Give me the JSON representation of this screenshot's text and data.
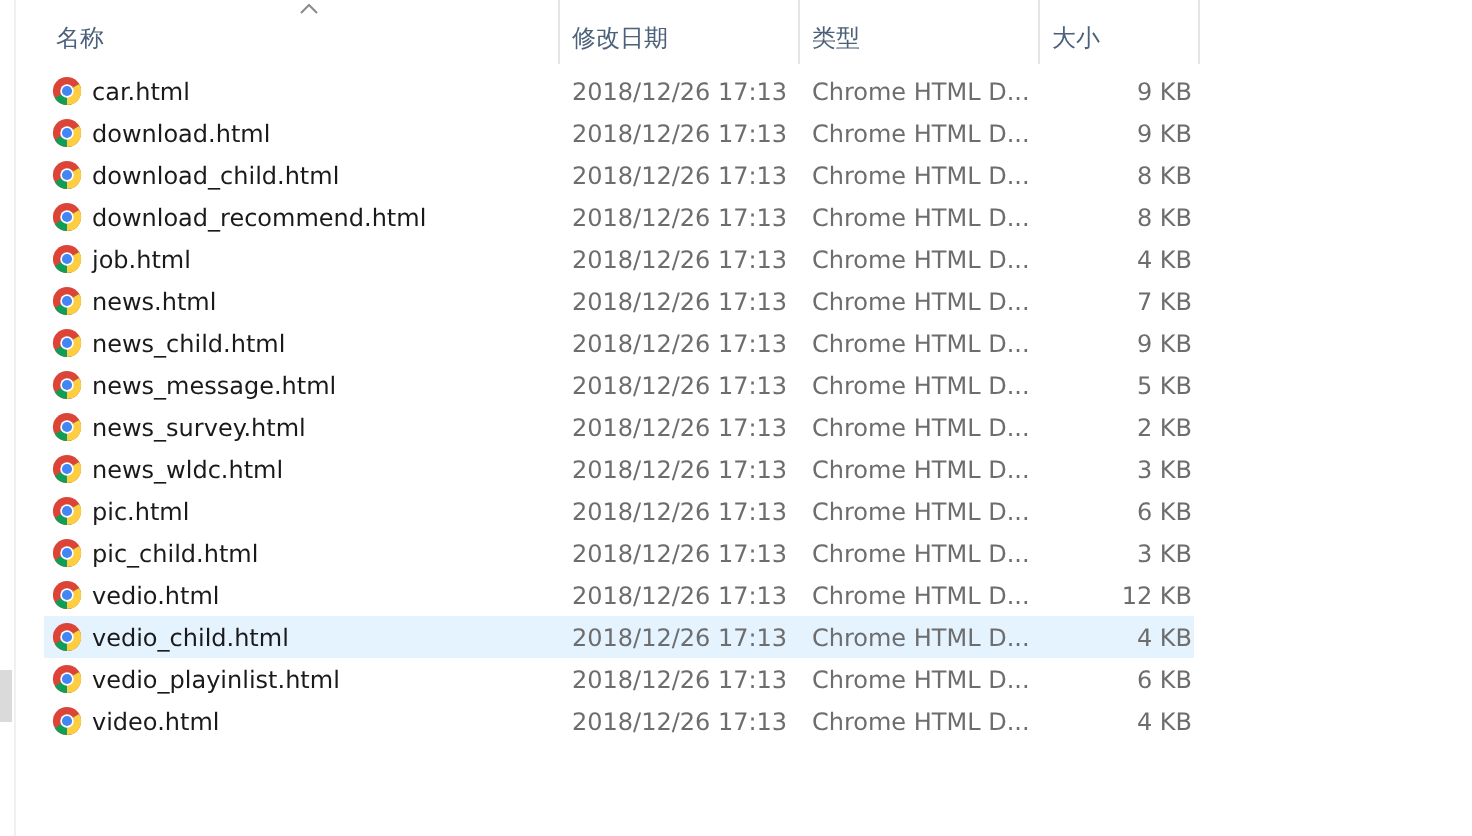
{
  "columns": [
    {
      "label": "名称",
      "sorted": true
    },
    {
      "label": "修改日期",
      "sorted": false
    },
    {
      "label": "类型",
      "sorted": false
    },
    {
      "label": "大小",
      "sorted": false
    }
  ],
  "files": [
    {
      "name": "car.html",
      "modified": "2018/12/26 17:13",
      "type": "Chrome HTML D...",
      "size": "9 KB",
      "selected": false
    },
    {
      "name": "download.html",
      "modified": "2018/12/26 17:13",
      "type": "Chrome HTML D...",
      "size": "9 KB",
      "selected": false
    },
    {
      "name": "download_child.html",
      "modified": "2018/12/26 17:13",
      "type": "Chrome HTML D...",
      "size": "8 KB",
      "selected": false
    },
    {
      "name": "download_recommend.html",
      "modified": "2018/12/26 17:13",
      "type": "Chrome HTML D...",
      "size": "8 KB",
      "selected": false
    },
    {
      "name": "job.html",
      "modified": "2018/12/26 17:13",
      "type": "Chrome HTML D...",
      "size": "4 KB",
      "selected": false
    },
    {
      "name": "news.html",
      "modified": "2018/12/26 17:13",
      "type": "Chrome HTML D...",
      "size": "7 KB",
      "selected": false
    },
    {
      "name": "news_child.html",
      "modified": "2018/12/26 17:13",
      "type": "Chrome HTML D...",
      "size": "9 KB",
      "selected": false
    },
    {
      "name": "news_message.html",
      "modified": "2018/12/26 17:13",
      "type": "Chrome HTML D...",
      "size": "5 KB",
      "selected": false
    },
    {
      "name": "news_survey.html",
      "modified": "2018/12/26 17:13",
      "type": "Chrome HTML D...",
      "size": "2 KB",
      "selected": false
    },
    {
      "name": "news_wldc.html",
      "modified": "2018/12/26 17:13",
      "type": "Chrome HTML D...",
      "size": "3 KB",
      "selected": false
    },
    {
      "name": "pic.html",
      "modified": "2018/12/26 17:13",
      "type": "Chrome HTML D...",
      "size": "6 KB",
      "selected": false
    },
    {
      "name": "pic_child.html",
      "modified": "2018/12/26 17:13",
      "type": "Chrome HTML D...",
      "size": "3 KB",
      "selected": false
    },
    {
      "name": "vedio.html",
      "modified": "2018/12/26 17:13",
      "type": "Chrome HTML D...",
      "size": "12 KB",
      "selected": false
    },
    {
      "name": "vedio_child.html",
      "modified": "2018/12/26 17:13",
      "type": "Chrome HTML D...",
      "size": "4 KB",
      "selected": true
    },
    {
      "name": "vedio_playinlist.html",
      "modified": "2018/12/26 17:13",
      "type": "Chrome HTML D...",
      "size": "6 KB",
      "selected": false
    },
    {
      "name": "video.html",
      "modified": "2018/12/26 17:13",
      "type": "Chrome HTML D...",
      "size": "4 KB",
      "selected": false
    }
  ]
}
